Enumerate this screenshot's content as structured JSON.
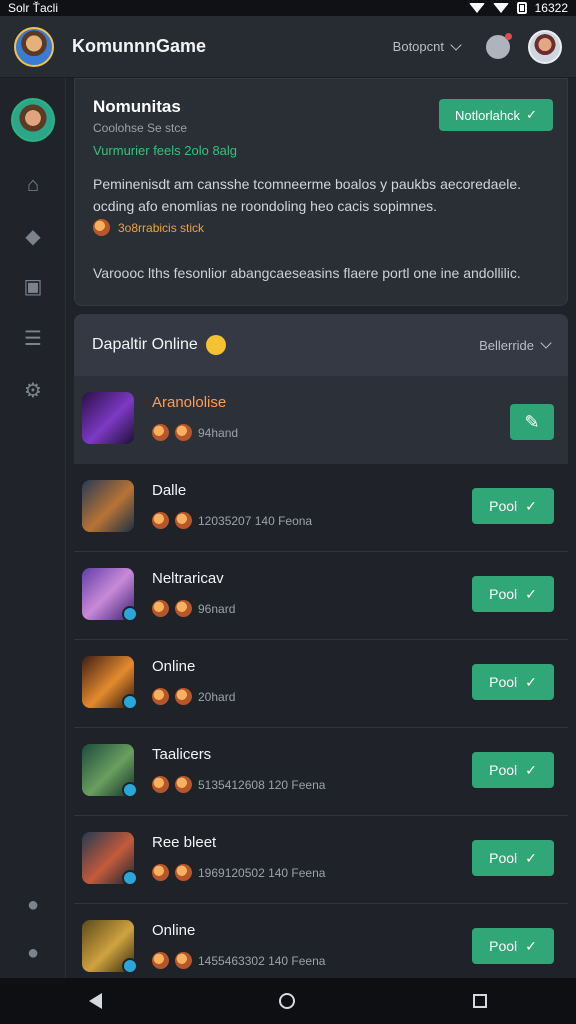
{
  "status": {
    "left": "Solr Ťacli",
    "time": "16322"
  },
  "app": {
    "title": "KomunnnGame",
    "filter": "Botopcnt"
  },
  "card": {
    "name": "Nomunitas",
    "subtitle": "Coolohse Se stce",
    "link": "Vurmurier feels 2olo 8alg",
    "description": "Peminenisdt am cansshe tcomneerme boalos y paukbs aecoredaele. ocding afo enomlias ne roondoling heo cacis sopimnes.",
    "rank_text": "3o8rrabicis stick",
    "footer": "Varoooc lths fesonlior abangcaeseasins flaere portl one ine andollilic.",
    "notify_button": "Notlorlahck"
  },
  "online": {
    "title": "Dapaltir Online",
    "sort": "Bellerride"
  },
  "rows": [
    {
      "name": "Aranololise",
      "meta": "94hand",
      "button": ""
    },
    {
      "name": "Dalle",
      "meta": "12035207 140 Feona",
      "button": "Pool"
    },
    {
      "name": "Neltraricav",
      "meta": "96nard",
      "button": "Pool"
    },
    {
      "name": "Online",
      "meta": "20hard",
      "button": "Pool"
    },
    {
      "name": "Taalicers",
      "meta": "5135412608 120 Feena",
      "button": "Pool"
    },
    {
      "name": "Ree bleet",
      "meta": "1969120502 140 Feena",
      "button": "Pool"
    },
    {
      "name": "Online",
      "meta": "1455463302 140 Feena",
      "button": "Pool"
    }
  ],
  "icons": [
    "home-icon",
    "gift-icon",
    "calendar-icon",
    "chat-icon",
    "settings-icon",
    "people-icon",
    "account-icon"
  ]
}
